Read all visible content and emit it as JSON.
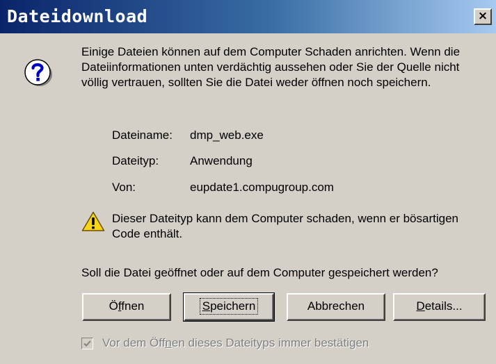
{
  "window": {
    "title": "Dateidownload",
    "close_label": "×"
  },
  "intro_text": "Einige Dateien können auf dem Computer Schaden anrichten. Wenn die Dateiinformationen unten verdächtig aussehen oder Sie der Quelle nicht völlig vertrauen, sollten Sie die Datei weder öffnen noch speichern.",
  "file_info": {
    "name_label": "Dateiname:",
    "name_value": "dmp_web.exe",
    "type_label": "Dateityp:",
    "type_value": "Anwendung",
    "from_label": "Von:",
    "from_value": "eupdate1.compugroup.com"
  },
  "warning_text": "Dieser Dateityp kann dem Computer schaden, wenn er bösartigen Code enthält.",
  "question_text": "Soll die Datei geöffnet oder auf dem Computer gespeichert werden?",
  "buttons": {
    "open_pre": "Ö",
    "open_ul": "f",
    "open_post": "fnen",
    "save_pre": "",
    "save_ul": "S",
    "save_post": "peichern",
    "cancel": "Abbrechen",
    "details_pre": "",
    "details_ul": "D",
    "details_post": "etails..."
  },
  "checkbox": {
    "label_pre": "Vor dem Öff",
    "label_ul": "n",
    "label_post": "en dieses Dateityps immer bestätigen",
    "checked": true
  },
  "icons": {
    "question": "question-mark-icon",
    "warning": "warning-triangle-icon"
  }
}
